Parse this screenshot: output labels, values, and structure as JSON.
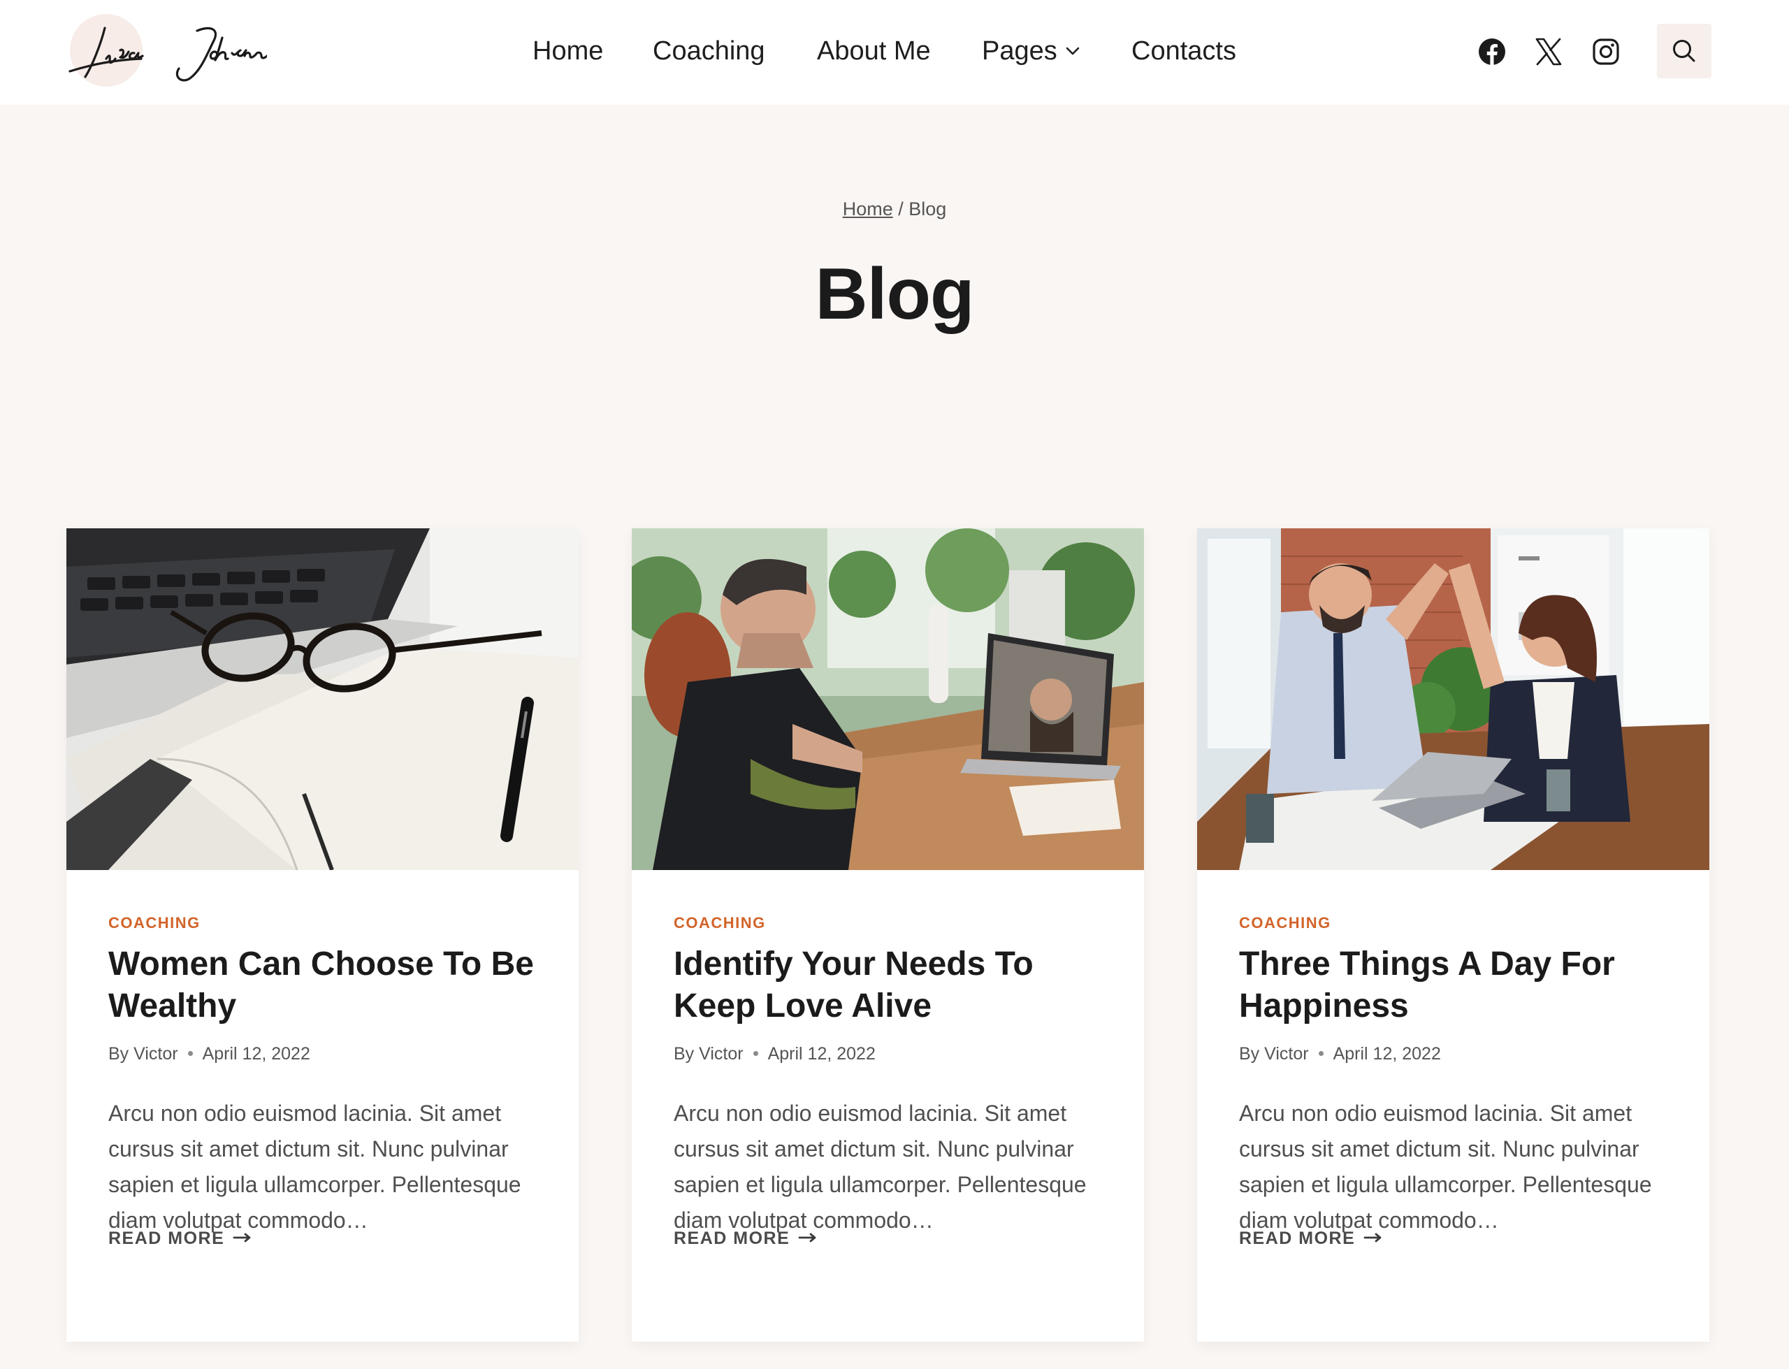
{
  "brand": {
    "logo_text": "Lisa Johnson"
  },
  "nav": {
    "items": [
      {
        "label": "Home"
      },
      {
        "label": "Coaching"
      },
      {
        "label": "About Me"
      },
      {
        "label": "Pages"
      },
      {
        "label": "Contacts"
      }
    ]
  },
  "social": [
    "facebook-icon",
    "x-icon",
    "instagram-icon"
  ],
  "breadcrumb": {
    "home": "Home",
    "separator": " / ",
    "current": "Blog"
  },
  "page": {
    "title": "Blog"
  },
  "colors": {
    "accent": "#d2642a",
    "page_bg": "#faf6f4",
    "card_bg": "#ffffff"
  },
  "posts": [
    {
      "category": "COACHING",
      "title": "Women Can Choose To Be Wealthy",
      "author": "By Victor",
      "date": "April 12, 2022",
      "excerpt": "Arcu non odio euismod lacinia. Sit amet cursus sit amet dictum sit. Nunc pulvinar sapien et ligula ullamcorper. Pellentesque diam volutpat commodo…",
      "read_more": "READ MORE"
    },
    {
      "category": "COACHING",
      "title": "Identify Your Needs To Keep Love Alive",
      "author": "By Victor",
      "date": "April 12, 2022",
      "excerpt": "Arcu non odio euismod lacinia. Sit amet cursus sit amet dictum sit. Nunc pulvinar sapien et ligula ullamcorper. Pellentesque diam volutpat commodo…",
      "read_more": "READ MORE"
    },
    {
      "category": "COACHING",
      "title": "Three Things A Day For Happiness",
      "author": "By Victor",
      "date": "April 12, 2022",
      "excerpt": "Arcu non odio euismod lacinia. Sit amet cursus sit amet dictum sit. Nunc pulvinar sapien et ligula ullamcorper. Pellentesque diam volutpat commodo…",
      "read_more": "READ MORE"
    }
  ]
}
